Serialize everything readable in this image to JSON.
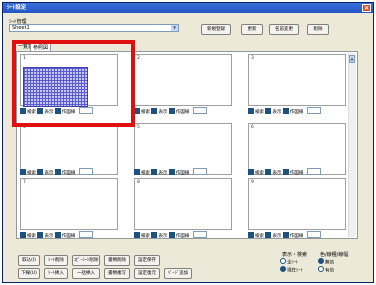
{
  "window": {
    "title": "ｼｰﾄ設定",
    "close_glyph": "×"
  },
  "sheet_mgmt": {
    "label": "ｼｰﾄ管理",
    "combo_value": "Sheet1",
    "buttons": [
      "新規登録",
      "更新",
      "名前変更",
      "削除"
    ]
  },
  "tabs": [
    {
      "label": "一覧表"
    },
    {
      "label": "参照図"
    }
  ],
  "cells": [
    {
      "num": "1",
      "has_image": true
    },
    {
      "num": "2",
      "has_image": false
    },
    {
      "num": "3",
      "has_image": false
    },
    {
      "num": "4",
      "has_image": false
    },
    {
      "num": "5",
      "has_image": false
    },
    {
      "num": "6",
      "has_image": false
    },
    {
      "num": "7",
      "has_image": false
    },
    {
      "num": "8",
      "has_image": false
    },
    {
      "num": "9",
      "has_image": false
    }
  ],
  "cell_options": {
    "opt1": "検索",
    "opt2": "表示",
    "opt3": "作図線"
  },
  "bottom_buttons": {
    "row1": [
      "取込(I)",
      "ｼｰﾄ削除",
      "ｺﾋﾟｰｼｰﾄ削除",
      "書類削除",
      "設定保存"
    ],
    "row2": [
      "下線(U)",
      "ｼｰﾄ挿入",
      "一括挿入",
      "書類複写",
      "設定復元",
      "ﾍﾟｰｼﾞ追加"
    ]
  },
  "display_group": {
    "title": "表示・検索",
    "opt_a": "全ｼｰﾄ",
    "opt_b": "現在ｼｰﾄ"
  },
  "style_group": {
    "title": "色/線種/線幅",
    "opt_a": "無効",
    "opt_b": "有効"
  },
  "colors": {
    "accent": "#2456c4",
    "highlight": "#e01010",
    "grid": "#5b5bd0"
  }
}
